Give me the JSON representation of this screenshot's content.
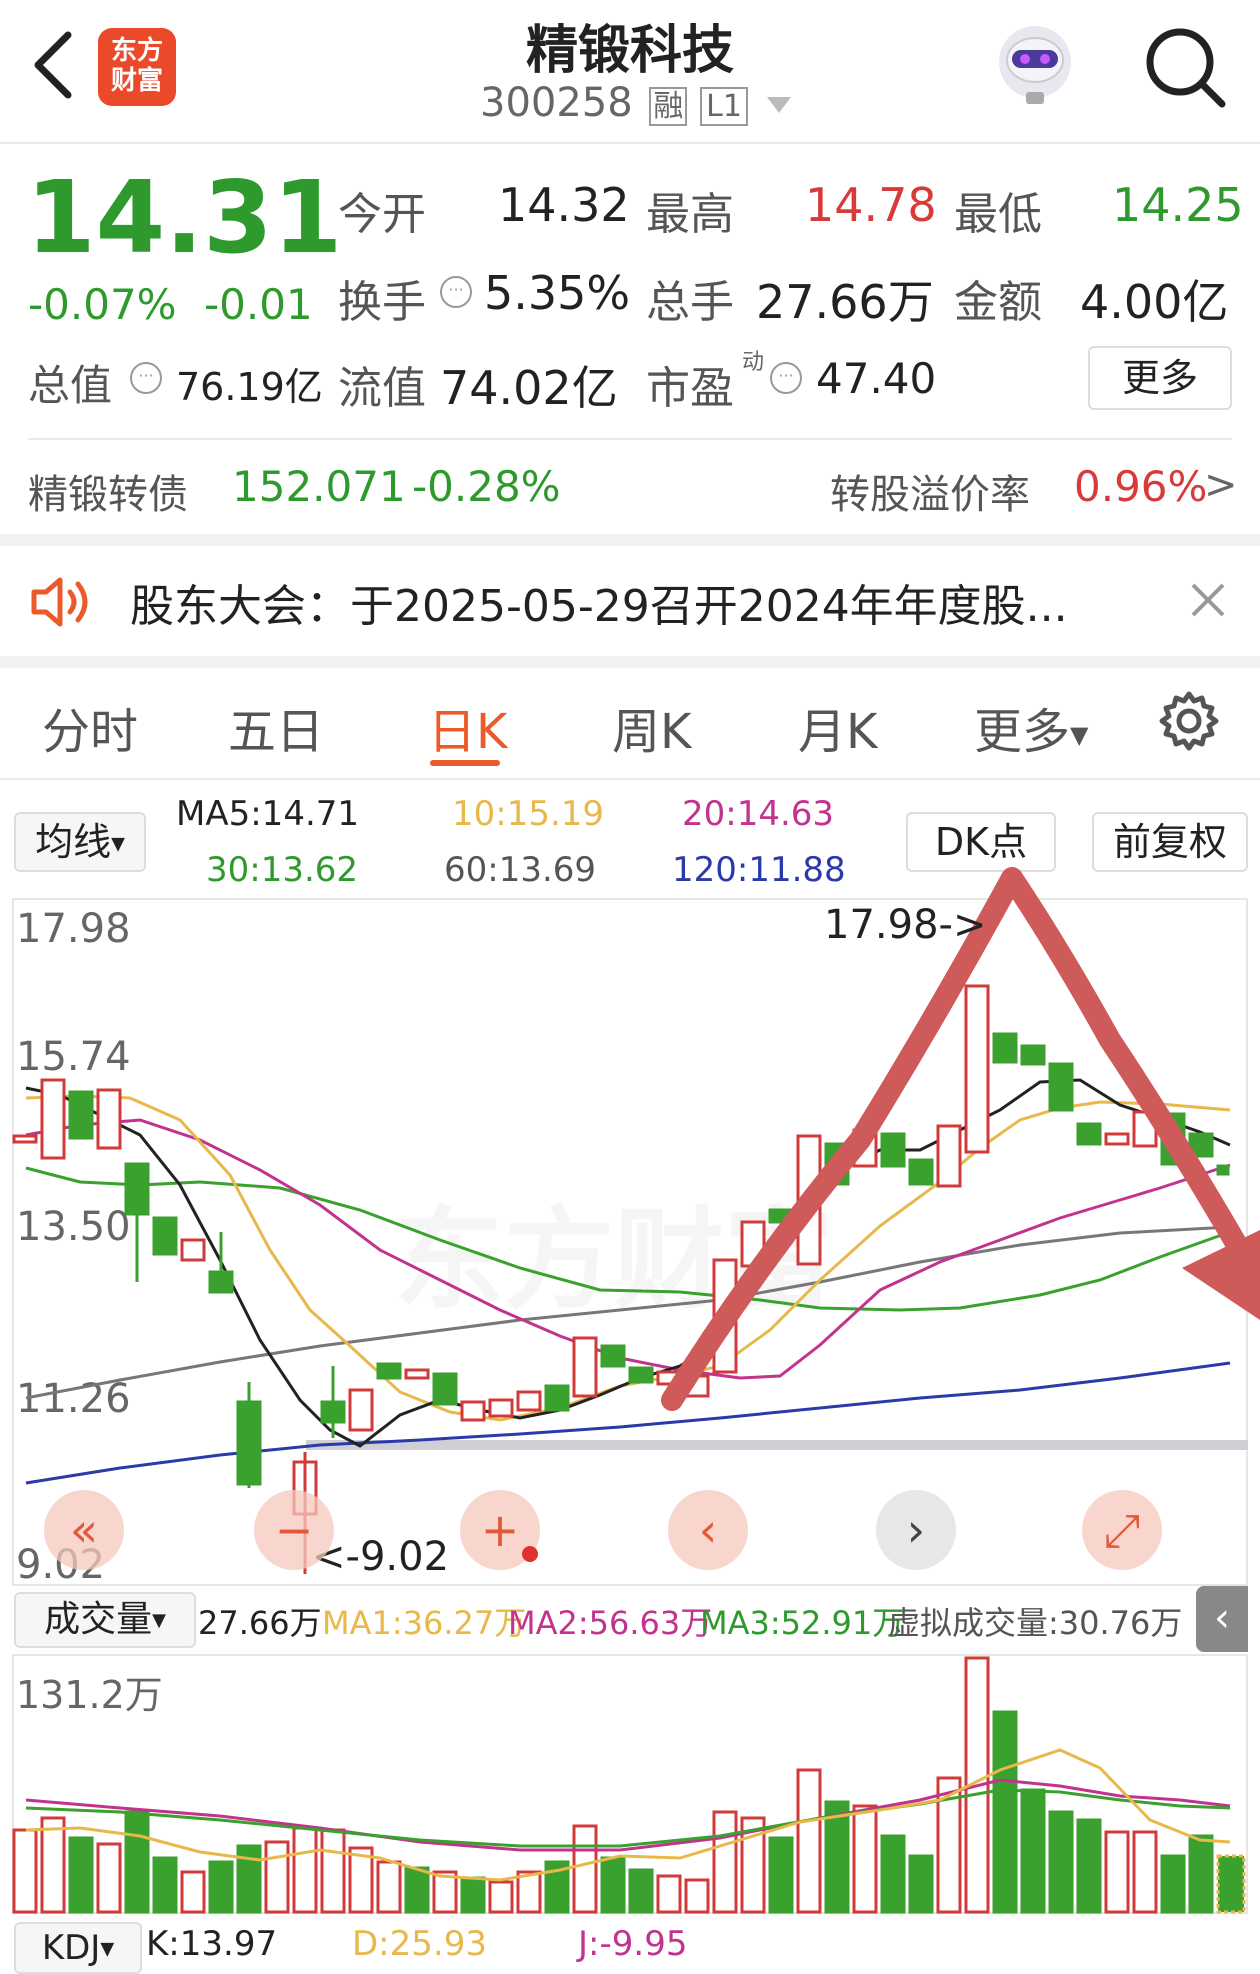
{
  "header": {
    "title": "精锻科技",
    "code": "300258",
    "tag_margin": "融",
    "tag_level": "L1",
    "logo_line1": "东方",
    "logo_line2": "财富"
  },
  "quote": {
    "price": "14.31",
    "change_pct": "-0.07%",
    "change": "-0.01",
    "open_label": "今开",
    "open": "14.32",
    "high_label": "最高",
    "high": "14.78",
    "low_label": "最低",
    "low": "14.25",
    "turnover_label": "换手",
    "turnover": "5.35%",
    "volume_label": "总手",
    "volume": "27.66万",
    "amount_label": "金额",
    "amount": "4.00亿",
    "mktcap_label": "总值",
    "mktcap": "76.19亿",
    "float_label": "流值",
    "float": "74.02亿",
    "pe_label": "市盈",
    "pe_sup": "动",
    "pe": "47.40",
    "more_button": "更多"
  },
  "bond": {
    "name": "精锻转债",
    "price": "152.071",
    "change_pct": "-0.28%",
    "premium_label": "转股溢价率",
    "premium": "0.96%",
    "arrow": ">"
  },
  "notice": {
    "text": "股东大会：于2025-05-29召开2024年年度股..."
  },
  "tabs": [
    {
      "label": "分时"
    },
    {
      "label": "五日"
    },
    {
      "label": "日K"
    },
    {
      "label": "周K"
    },
    {
      "label": "月K"
    },
    {
      "label": "更多"
    }
  ],
  "ma_bar": {
    "selector": "均线",
    "ma5": "MA5:14.71",
    "ma10": "10:15.19",
    "ma20": "20:14.63",
    "ma30": "30:13.62",
    "ma60": "60:13.69",
    "ma120": "120:11.88",
    "dk_button": "DK点",
    "adjust_button": "前复权"
  },
  "kline": {
    "y_labels": [
      "17.98",
      "15.74",
      "13.50",
      "11.26",
      "9.02"
    ],
    "max_label": "17.98->",
    "min_label": "<-9.02",
    "watermark": "东方财富",
    "colors": {
      "up": "#d03a3a",
      "down": "#3aa02e",
      "ma5": "#222222",
      "ma10": "#e8b84a",
      "ma20": "#c2338e",
      "ma30": "#3aa02e",
      "ma60": "#777777",
      "ma120": "#2a3aa8",
      "arrow": "#d05a5a"
    }
  },
  "volume_bar": {
    "selector": "成交量",
    "vol": "27.66万",
    "ma1": "MA1:36.27万",
    "ma2": "MA2:56.63万",
    "ma3": "MA3:52.91万",
    "virtual": "虚拟成交量:30.76万",
    "y_max": "131.2万"
  },
  "kdj_bar": {
    "selector": "KDJ",
    "k": "K:13.97",
    "d": "D:25.93",
    "j": "J:-9.95"
  },
  "icons": {
    "back": "chevron-left-icon",
    "search": "search-icon",
    "robot": "robot-avatar-icon",
    "speaker": "speaker-icon",
    "close": "close-icon",
    "settings": "gear-icon"
  }
}
